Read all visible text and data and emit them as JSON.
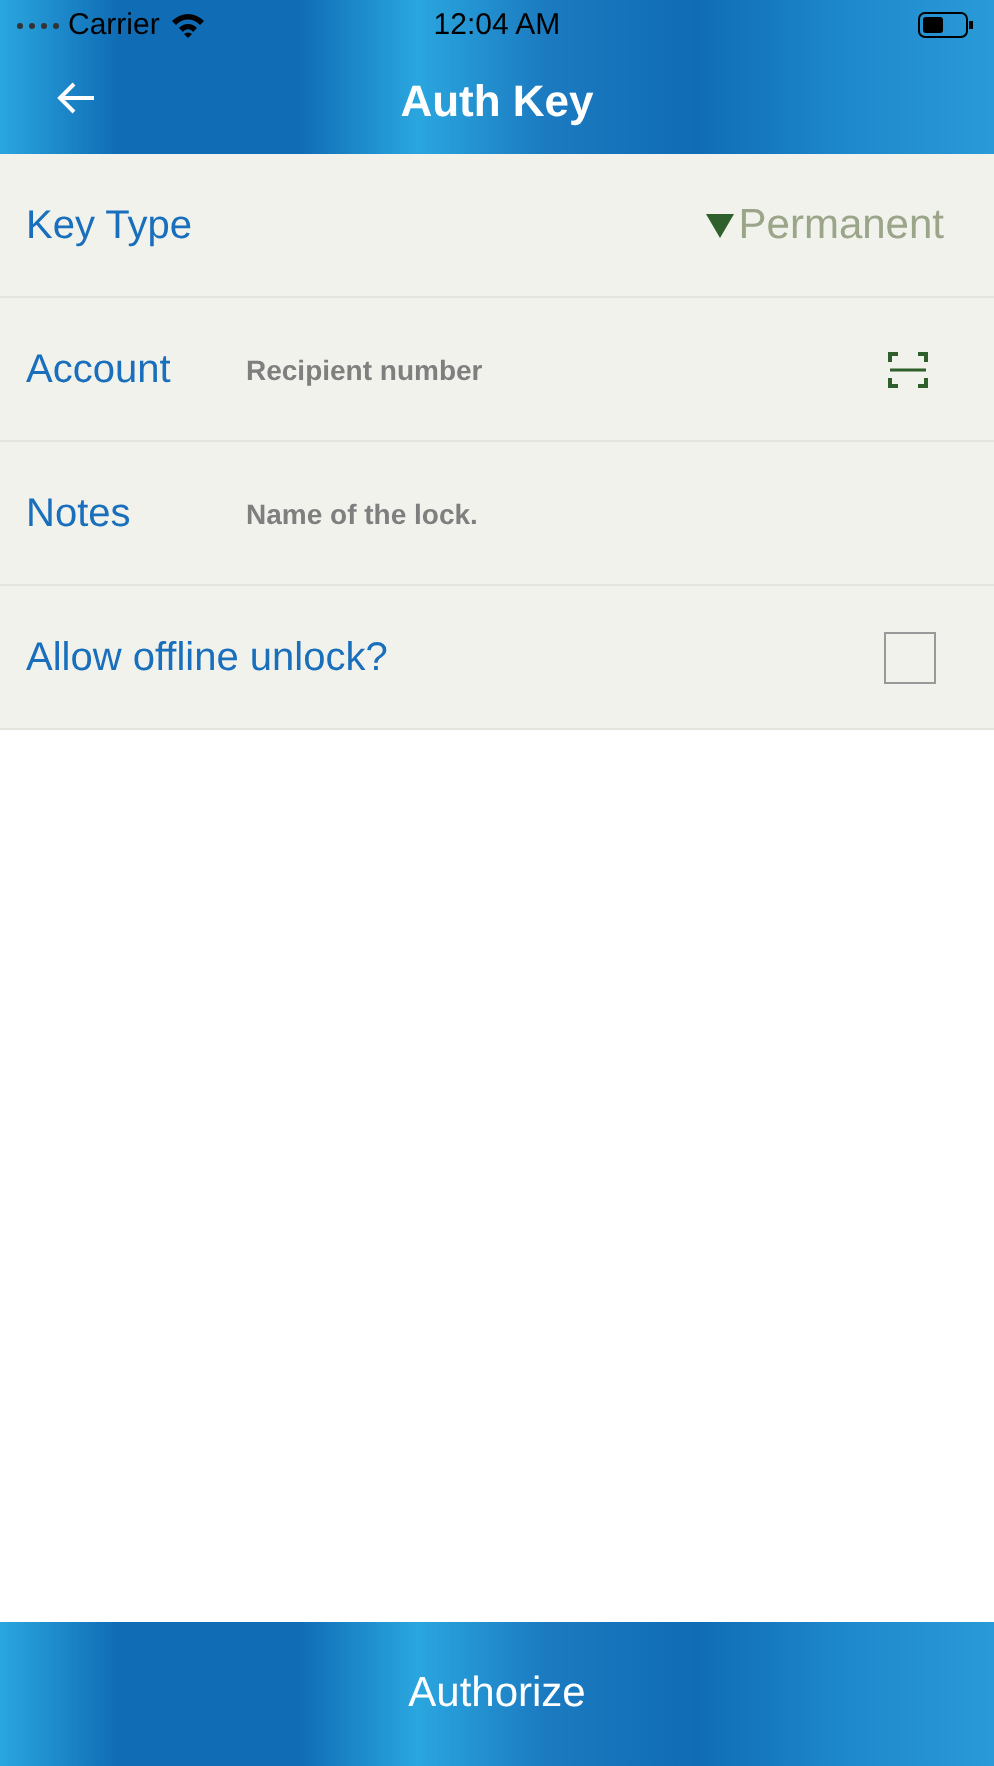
{
  "status_bar": {
    "carrier": "Carrier",
    "time": "12:04 AM"
  },
  "header": {
    "title": "Auth Key"
  },
  "rows": [
    {
      "kind": "select",
      "label": "Key Type",
      "value": "Permanent"
    },
    {
      "kind": "scan-input",
      "label": "Account",
      "placeholder": "Recipient number"
    },
    {
      "kind": "input",
      "label": "Notes",
      "placeholder": "Name of the lock."
    },
    {
      "kind": "checkbox",
      "label": "Allow offline unlock?",
      "checked": false
    }
  ],
  "footer": {
    "button": "Authorize"
  }
}
